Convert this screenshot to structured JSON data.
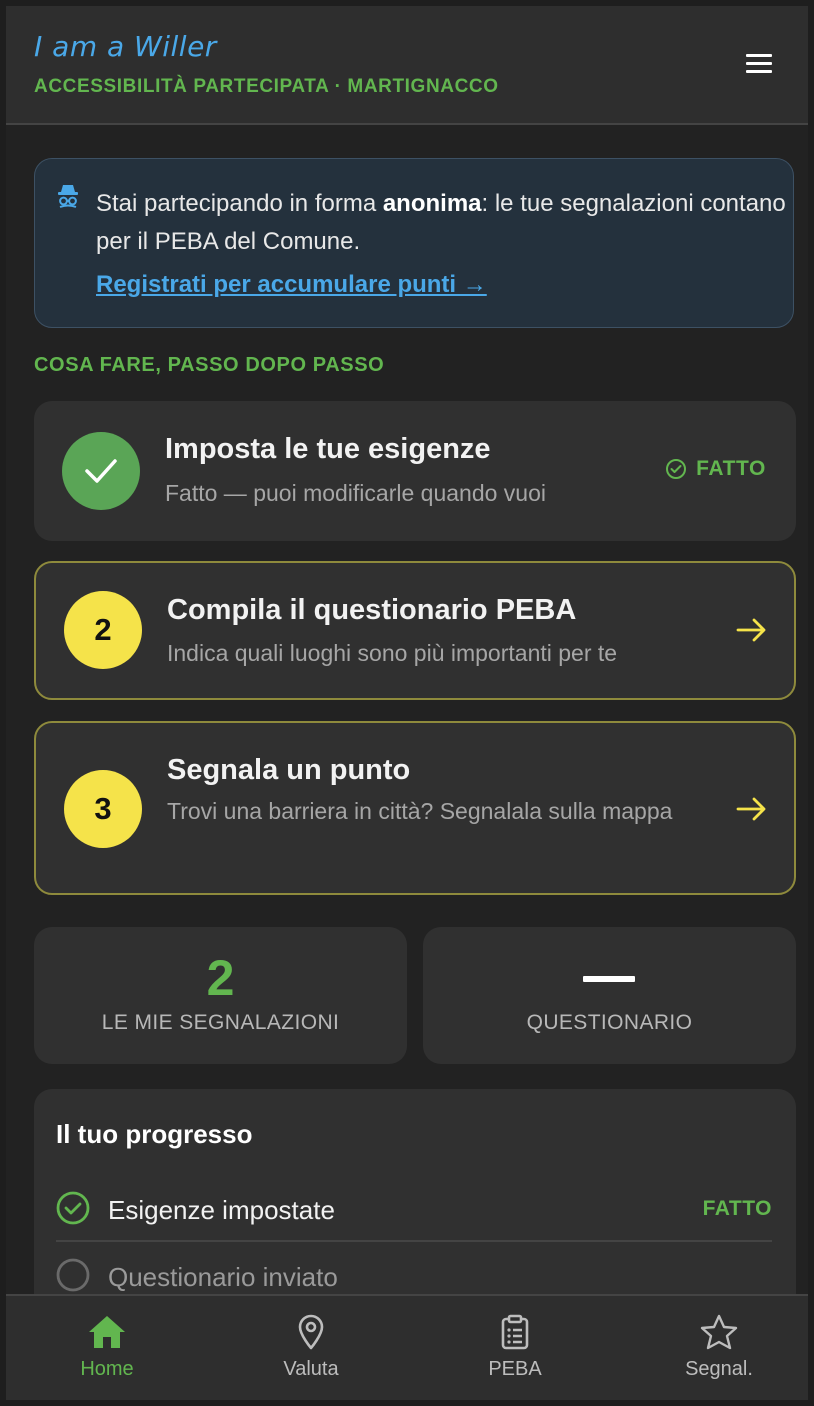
{
  "header": {
    "brand": "I am a Willer",
    "subtitle": "ACCESSIBILITÀ PARTECIPATA · MARTIGNACCO"
  },
  "banner": {
    "text_prefix": "Stai partecipando in forma ",
    "text_bold": "anonima",
    "text_suffix": ": le tue segnalazioni contano per il PEBA del Comune.",
    "link": "Registrati per accumulare punti →"
  },
  "steps_heading": "COSA FARE, PASSO DOPO PASSO",
  "steps": [
    {
      "title": "Imposta le tue esigenze",
      "desc": "Fatto — puoi modificarle quando vuoi",
      "status": "FATTO",
      "done": true
    },
    {
      "number": "2",
      "title": "Compila il questionario PEBA",
      "desc": "Indica quali luoghi sono più importanti per te"
    },
    {
      "number": "3",
      "title": "Segnala un punto",
      "desc": "Trovi una barriera in città? Segnalala sulla mappa"
    }
  ],
  "stats": {
    "reports_value": "2",
    "reports_label": "LE MIE SEGNALAZIONI",
    "survey_label": "QUESTIONARIO"
  },
  "progress": {
    "title": "Il tuo progresso",
    "items": [
      {
        "label": "Esigenze impostate",
        "status": "FATTO",
        "done": true
      },
      {
        "label": "Questionario inviato",
        "status": "",
        "done": false
      }
    ]
  },
  "nav": [
    {
      "label": "Home",
      "icon": "home-icon",
      "active": true
    },
    {
      "label": "Valuta",
      "icon": "map-pin-icon",
      "active": false
    },
    {
      "label": "PEBA",
      "icon": "clipboard-icon",
      "active": false
    },
    {
      "label": "Segnal.",
      "icon": "star-icon",
      "active": false
    }
  ],
  "colors": {
    "accent_green": "#62b64f",
    "accent_blue": "#4aa8e8",
    "accent_yellow": "#f5e34a",
    "background": "#222222",
    "card": "#303030"
  }
}
